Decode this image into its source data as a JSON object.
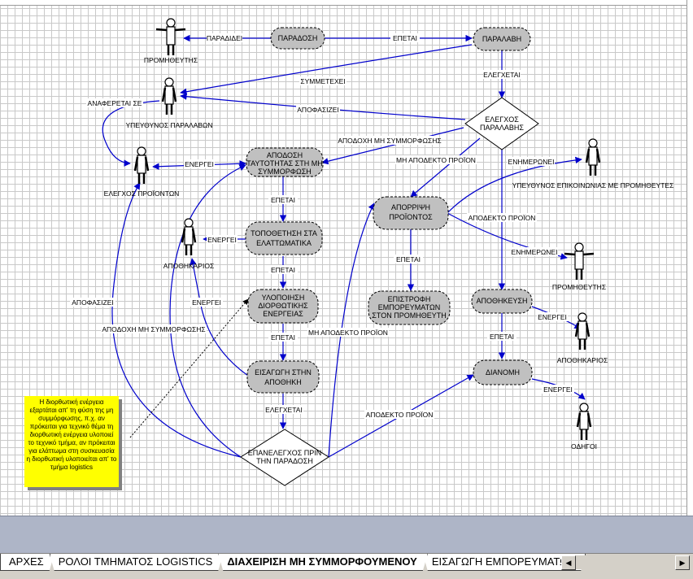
{
  "processes": {
    "paradosi": "ΠΑΡΑΔΟΣΗ",
    "paralavi": "ΠΑΡΑΛΑΒΗ",
    "apodosi_1": "ΑΠΟΔΟΣΗ",
    "apodosi_2": "ΤΑΥΤΟΤΗΤΑΣ ΣΤΗ ΜΗ",
    "apodosi_3": "ΣΥΜΜΟΡΦΩΣΗ",
    "topothetisi_1": "ΤΟΠΟΘΕΤΗΣΗ ΣΤΑ",
    "topothetisi_2": "ΕΛΑΤΤΩΜΑΤΙΚΑ",
    "ylopoiisi_1": "ΥΛΟΠΟΙΗΣΗ",
    "ylopoiisi_2": "ΔΙΟΡΘΩΤΙΚΗΣ",
    "ylopoiisi_3": "ΕΝΕΡΓΕΙΑΣ",
    "eisagogi_1": "ΕΙΣΑΓΩΓΗ ΣΤΗΝ",
    "eisagogi_2": "ΑΠΟΘΗΚΗ",
    "aporripsi_1": "ΑΠΟΡΡΙΨΗ",
    "aporripsi_2": "ΠΡΟΪΟΝΤΟΣ",
    "epistrofi_1": "ΕΠΙΣΤΡΟΦΗ",
    "epistrofi_2": "ΕΜΠΟΡΕΥΜΑΤΩΝ",
    "epistrofi_3": "ΣΤΟΝ ΠΡΟΜΗΘΕΥΤΗ",
    "apothikeusi": "ΑΠΟΘΗΚΕΥΣΗ",
    "dianomi": "ΔΙΑΝΟΜΗ"
  },
  "decisions": {
    "elegxos_1": "ΕΛΕΓΧΟΣ",
    "elegxos_2": "ΠΑΡΑΛΑΒΗΣ",
    "epanelegxos_1": "ΕΠΑΝΕΛΕΓΧΟΣ ΠΡΙΝ",
    "epanelegxos_2": "ΤΗΝ ΠΑΡΑΔΟΣΗ"
  },
  "actors": {
    "promitheftis_top": "ΠΡΟΜΗΘΕΥΤΗΣ",
    "ypeuthinos_paralavon": "ΥΠΕΥΘΥΝΟΣ ΠΑΡΑΛΑΒΩΝ",
    "elegxos_proionton": "ΕΛΕΓΧΟΣ ΠΡΟΪΟΝΤΩΝ",
    "apothikarios_left": "ΑΠΟΘΗΚΑΡΙΟΣ",
    "ypeuthinos_epikoinonias": "ΥΠΕΥΘΥΝΟΣ ΕΠΙΚΟΙΝΩΝΙΑΣ ΜΕ ΠΡΟΜΗΘΕΥΤΕΣ",
    "promitheftis_right": "ΠΡΟΜΗΘΕΥΤΗΣ",
    "apothikarios_right": "ΑΠΟΘΗΚΑΡΙΟΣ",
    "odigoi": "ΟΔΗΓΟΙ"
  },
  "edge_labels": {
    "paradidei": "ΠΑΡΑΔΙΔΕΙ",
    "epetai_top": "ΕΠΕΤΑΙ",
    "symmetexei": "ΣΥΜΜΕΤΕΧΕΙ",
    "elegxetai_top": "ΕΛΕΓΧΕΤΑΙ",
    "anaferetai_se": "ΑΝΑΦΕΡΕΤΑΙ ΣΕ",
    "apofasizei_top": "ΑΠΟΦΑΣΙΖΕΙ",
    "apodoxi_mi_symm_top": "ΑΠΟΔΟΧΗ ΜΗ ΣΥΜΜΟΡΦΩΣΗΣ",
    "mi_apodekto_top": "ΜΗ ΑΠΟΔΕΚΤΟ ΠΡΟΪΟΝ",
    "enimeronei_top": "ΕΝΗΜΕΡΩΝΕΙ",
    "energei_elegxos": "ΕΝΕΡΓΕΙ",
    "epetai_1": "ΕΠΕΤΑΙ",
    "apodekto_proion_right": "ΑΠΟΔΕΚΤΟ ΠΡΟΪΟΝ",
    "energei_apothikarios": "ΕΝΕΡΓΕΙ",
    "epetai_aporripsi": "ΕΠΕΤΑΙ",
    "enimeronei_right": "ΕΝΗΜΕΡΩΝΕΙ",
    "epetai_2": "ΕΠΕΤΑΙ",
    "apofasizei_left": "ΑΠΟΦΑΣΙΖΕΙ",
    "energei_left": "ΕΝΕΡΓΕΙ",
    "energei_apothikeusi": "ΕΝΕΡΓΕΙ",
    "apodoxi_mi_symm_left": "ΑΠΟΔΟΧΗ ΜΗ ΣΥΜΜΟΡΦΩΣΗΣ",
    "mi_apodekto_bottom": "ΜΗ ΑΠΟΔΕΚΤΟ ΠΡΟΪΟΝ",
    "epetai_3": "ΕΠΕΤΑΙ",
    "epetai_apothikeusi": "ΕΠΕΤΑΙ",
    "energei_dianomi": "ΕΝΕΡΓΕΙ",
    "elegxetai_bottom": "ΕΛΕΓΧΕΤΑΙ",
    "apodekto_proion_bottom": "ΑΠΟΔΕΚΤΟ ΠΡΟΪΟΝ"
  },
  "note": {
    "text": "Η διορθωτική ενέργεια εξαρτάται απ' τη φύση της μη συμμόρφωσης, π.χ. αν πρόκειται για τεχνικό θέμα τη διορθωτική ενέργεια υλοποιεί το τεχνικό τμήμα, αν πρόκειται για ελάττωμα στη συσκευασία η διορθωτική υλοποιείται απ' το τμήμα logistics"
  },
  "sheet_tabs": [
    {
      "label": "ΑΡΧΕΣ",
      "active": false
    },
    {
      "label": "ΡΟΛΟΙ ΤΜΗΜΑΤΟΣ LOGISTICS",
      "active": false
    },
    {
      "label": "ΔΙΑΧΕΙΡΙΣΗ ΜΗ ΣΥΜΜΟΡΦΟΥΜΕΝΟΥ",
      "active": true
    },
    {
      "label": "ΕΙΣΑΓΩΓΗ ΕΜΠΟΡΕΥΜΑΤΩΝ",
      "active": false
    }
  ],
  "colors": {
    "connector": "#0000cc",
    "process_fill": "#c0c0c0",
    "note_fill": "#ffff00",
    "grid": "#c9c9c9"
  }
}
